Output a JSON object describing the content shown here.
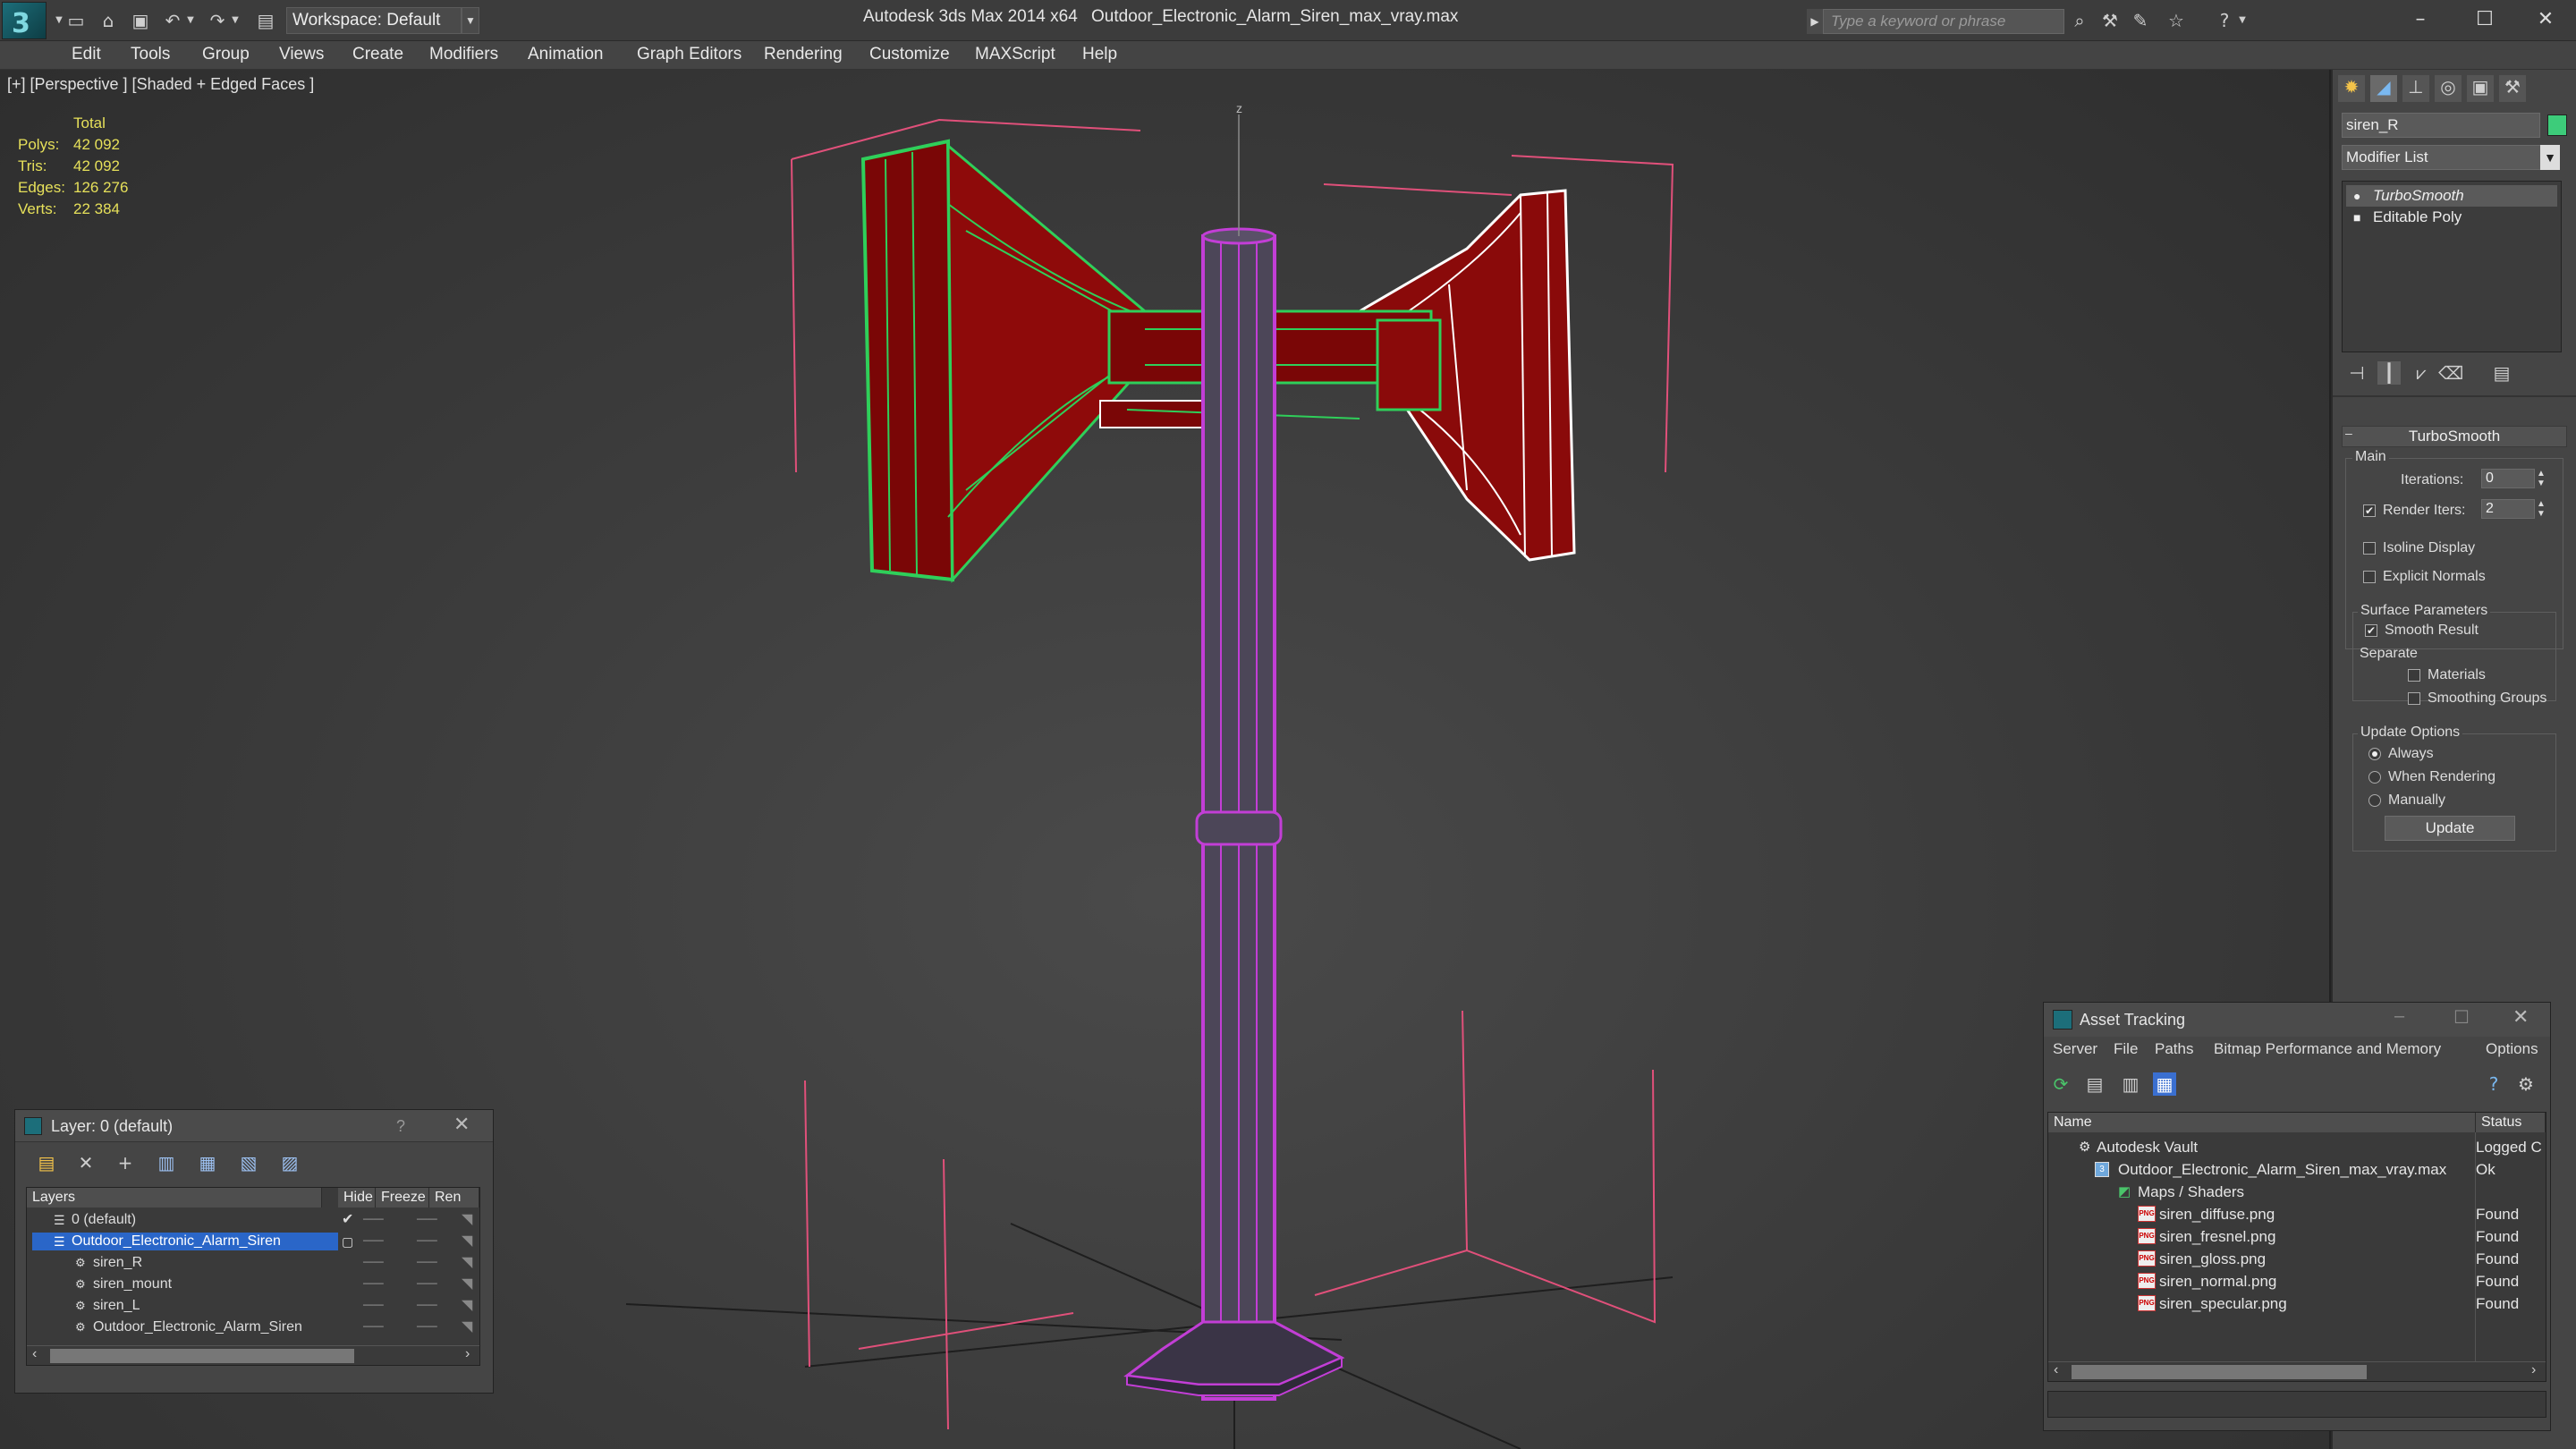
{
  "titlebar": {
    "app_title": "Autodesk 3ds Max  2014 x64",
    "file_title": "Outdoor_Electronic_Alarm_Siren_max_vray.max",
    "workspace": "Workspace: Default",
    "search_placeholder": "Type a keyword or phrase"
  },
  "menu": [
    "Edit",
    "Tools",
    "Group",
    "Views",
    "Create",
    "Modifiers",
    "Animation",
    "Graph Editors",
    "Rendering",
    "Customize",
    "MAXScript",
    "Help"
  ],
  "viewport": {
    "label": "[+] [Perspective ] [Shaded + Edged Faces ]",
    "stats": {
      "header": "Total",
      "rows": [
        {
          "label": "Polys:",
          "value": "42 092"
        },
        {
          "label": "Tris:",
          "value": "42 092"
        },
        {
          "label": "Edges:",
          "value": "126 276"
        },
        {
          "label": "Verts:",
          "value": "22 384"
        }
      ]
    },
    "axis_label": "z"
  },
  "command_panel": {
    "object_name": "siren_R",
    "object_color": "#3dcc7a",
    "modifier_list": "Modifier List",
    "stack": [
      "TurboSmooth",
      "Editable Poly"
    ],
    "turbosmooth": {
      "title": "TurboSmooth",
      "main": "Main",
      "iterations_label": "Iterations:",
      "iterations": "0",
      "render_iters_label": "Render Iters:",
      "render_iters": "2",
      "isoline": "Isoline Display",
      "explicit_normals": "Explicit Normals",
      "surface_params": "Surface Parameters",
      "smooth_result": "Smooth Result",
      "separate": "Separate",
      "materials": "Materials",
      "smoothing_groups": "Smoothing Groups",
      "update_options": "Update Options",
      "always": "Always",
      "when_rendering": "When Rendering",
      "manually": "Manually",
      "update_button": "Update"
    }
  },
  "layer_window": {
    "title": "Layer: 0 (default)",
    "help": "?",
    "columns": [
      "Layers",
      "Hide",
      "Freeze",
      "Ren"
    ],
    "rows": [
      {
        "name": "0 (default)",
        "indent": 0,
        "selected": false,
        "current": true
      },
      {
        "name": "Outdoor_Electronic_Alarm_Siren",
        "indent": 0,
        "selected": true,
        "current": false
      },
      {
        "name": "siren_R",
        "indent": 1,
        "selected": false,
        "current": false
      },
      {
        "name": "siren_mount",
        "indent": 1,
        "selected": false,
        "current": false
      },
      {
        "name": "siren_L",
        "indent": 1,
        "selected": false,
        "current": false
      },
      {
        "name": "Outdoor_Electronic_Alarm_Siren",
        "indent": 1,
        "selected": false,
        "current": false
      }
    ]
  },
  "asset_window": {
    "title": "Asset Tracking",
    "menu": [
      "Server",
      "File",
      "Paths",
      "Bitmap Performance and Memory",
      "Options"
    ],
    "columns": [
      "Name",
      "Status"
    ],
    "rows": [
      {
        "name": "Autodesk Vault",
        "status": "Logged C",
        "indent": 1,
        "icon": "vault"
      },
      {
        "name": "Outdoor_Electronic_Alarm_Siren_max_vray.max",
        "status": "Ok",
        "indent": 2,
        "icon": "max"
      },
      {
        "name": "Maps / Shaders",
        "status": "",
        "indent": 3,
        "icon": "folder"
      },
      {
        "name": "siren_diffuse.png",
        "status": "Found",
        "indent": 4,
        "icon": "png"
      },
      {
        "name": "siren_fresnel.png",
        "status": "Found",
        "indent": 4,
        "icon": "png"
      },
      {
        "name": "siren_gloss.png",
        "status": "Found",
        "indent": 4,
        "icon": "png"
      },
      {
        "name": "siren_normal.png",
        "status": "Found",
        "indent": 4,
        "icon": "png"
      },
      {
        "name": "siren_specular.png",
        "status": "Found",
        "indent": 4,
        "icon": "png"
      }
    ]
  }
}
